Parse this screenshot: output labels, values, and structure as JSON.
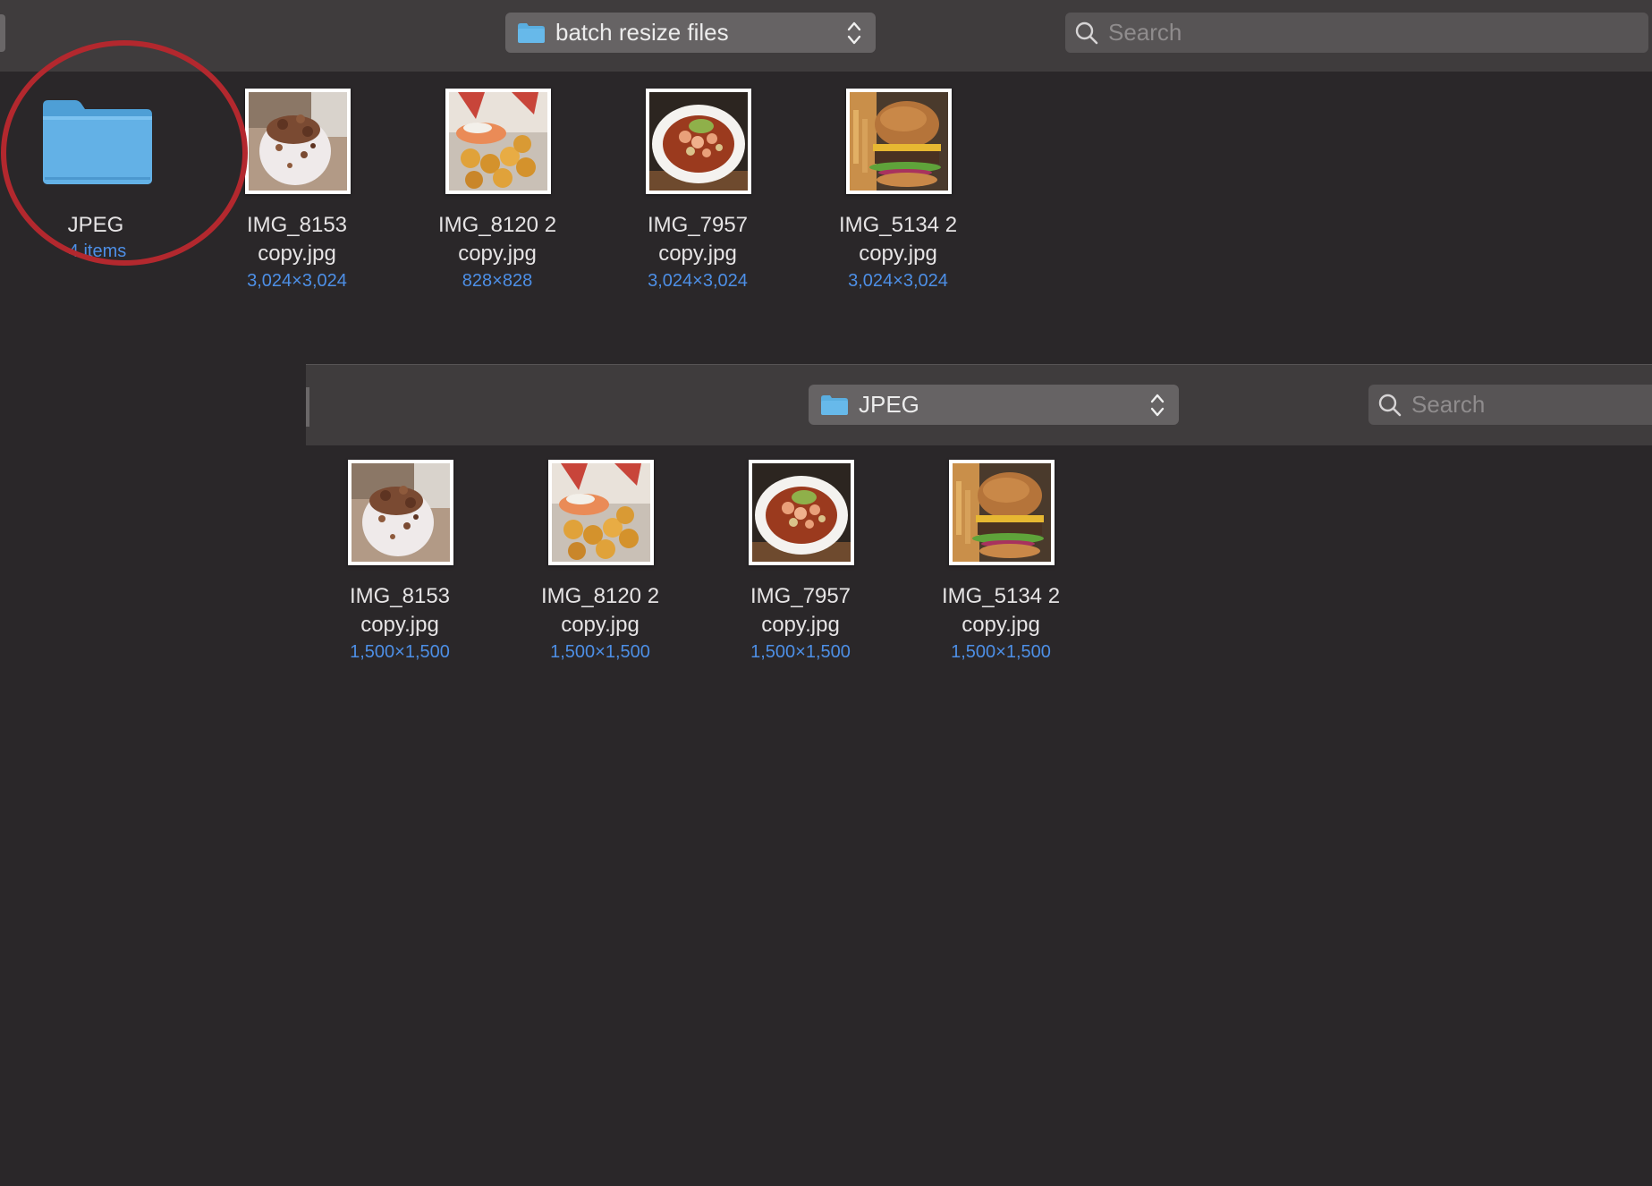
{
  "window1": {
    "path_label": "batch resize files",
    "search_placeholder": "Search",
    "folder": {
      "name": "JPEG",
      "meta": "4 items"
    },
    "files": [
      {
        "name_line1": "IMG_8153",
        "name_line2": "copy.jpg",
        "dims": "3,024×3,024"
      },
      {
        "name_line1": "IMG_8120 2",
        "name_line2": "copy.jpg",
        "dims": "828×828"
      },
      {
        "name_line1": "IMG_7957",
        "name_line2": "copy.jpg",
        "dims": "3,024×3,024"
      },
      {
        "name_line1": "IMG_5134 2",
        "name_line2": "copy.jpg",
        "dims": "3,024×3,024"
      }
    ]
  },
  "window2": {
    "path_label": "JPEG",
    "search_placeholder": "Search",
    "files": [
      {
        "name_line1": "IMG_8153",
        "name_line2": "copy.jpg",
        "dims": "1,500×1,500"
      },
      {
        "name_line1": "IMG_8120 2",
        "name_line2": "copy.jpg",
        "dims": "1,500×1,500"
      },
      {
        "name_line1": "IMG_7957",
        "name_line2": "copy.jpg",
        "dims": "1,500×1,500"
      },
      {
        "name_line1": "IMG_5134 2",
        "name_line2": "copy.jpg",
        "dims": "1,500×1,500"
      }
    ]
  },
  "colors": {
    "background": "#2a2729",
    "toolbar": "#3f3c3d",
    "accent_blue": "#4d8fe6",
    "folder_blue": "#5aaee0",
    "annotation_red": "#b3282e"
  },
  "icons": [
    "folder-icon",
    "chevron-up-down-icon",
    "search-icon"
  ]
}
